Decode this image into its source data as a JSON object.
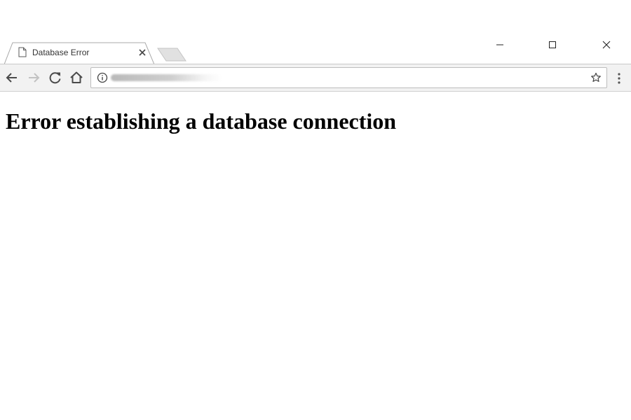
{
  "browser": {
    "tab": {
      "title": "Database Error",
      "icon": "document-icon"
    },
    "window_controls": [
      "minimize-icon",
      "maximize-icon",
      "close-icon"
    ],
    "toolbar": {
      "buttons": [
        "back-arrow-icon",
        "forward-arrow-icon",
        "reload-icon",
        "home-icon"
      ],
      "address_bar": {
        "security_icon": "info-icon",
        "bookmark_icon": "star-icon"
      },
      "menu_icon": "more-vert-icon"
    }
  },
  "page": {
    "heading": "Error establishing a database connection"
  },
  "colors": {
    "toolbar_background": "#f2f2f2",
    "page_background": "#ffffff",
    "heading_text": "#000000"
  }
}
